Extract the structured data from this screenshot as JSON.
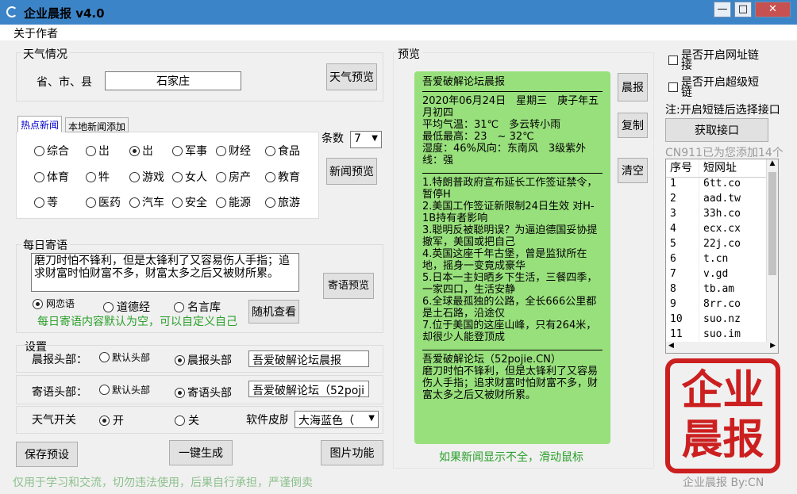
{
  "window": {
    "title": "企业晨报 v4.0",
    "min": "—",
    "max": "□",
    "close": "✕"
  },
  "menu": {
    "about": "关于作者"
  },
  "weather": {
    "group_title": "天气情况",
    "region_label": "省、市、县",
    "region_value": "石家庄",
    "preview_button": "天气预览"
  },
  "news": {
    "tabs": [
      "热点新闻",
      "本地新闻添加"
    ],
    "categories": [
      "综合",
      "岀",
      "岀",
      "军事",
      "财经",
      "食品",
      "体育",
      "牪",
      "游戏",
      "女人",
      "房产",
      "教育",
      "䓁",
      "医药",
      "汽车",
      "安全",
      "能源",
      "旅游"
    ],
    "selected_index": 2,
    "count_label": "条数",
    "count_value": "7",
    "preview_button": "新闻预览"
  },
  "quote": {
    "group_title": "每日寄语",
    "text": "磨刀时怕不锋利，但是太锋利了又容易伤人手指；追求财富时怕财富不多，财富太多之后又被财所累。",
    "options": [
      "网恋语",
      "道德经",
      "名言库"
    ],
    "selected_index": 0,
    "random_button": "随机查看",
    "preview_button": "寄语预览",
    "hint": "每日寄语内容默认为空，可以自定义自己"
  },
  "settings": {
    "group_title": "设置",
    "header_label": "晨报头部：",
    "header_default": "默认头部",
    "header_custom": "晨报头部",
    "header_value": "吾爱破解论坛晨报",
    "quote_label": "寄语头部：",
    "quote_default": "默认头部",
    "quote_custom": "寄语头部",
    "quote_value": "吾爱破解论坛（52poji",
    "weather_label": "天气开关",
    "weather_on": "开",
    "weather_off": "关",
    "skin_label": "软件皮肤",
    "skin_value": "大海蓝色（"
  },
  "bottom_buttons": {
    "save": "保存预设",
    "generate": "一键生成",
    "image": "图片功能"
  },
  "preview": {
    "group_title": "预览",
    "title": "吾爱破解论坛晨报",
    "weather_lines": [
      "2020年06月24日　星期三　庚子年五月初四",
      "平均气温：31℃　多云转小雨",
      "最低最高：23　~ 32℃",
      "湿度：46%风向：东南风　3级紫外线：强"
    ],
    "news_lines": [
      "1.特朗普政府宣布延长工作签证禁令，暂停H",
      "2.美国工作签证新限制24日生效 对H-1B持有者影响",
      "3.聪明反被聪明误？为逼迫德国妥协提撤军，美国或把自己",
      "4.英国这座千年古堡，曾是监狱所在地，摇身一变竟成豪华",
      "5.日本一主妇晒乡下生活，三餐四季，一家四口，生活安静",
      "6.全球最孤独的公路，全长666公里都是土石路，沿途仅",
      "7.位于美国的这座山峰，只有264米，却很少人能登顶成"
    ],
    "footer_lines": [
      "吾爱破解论坛（52pojie.CN）",
      "磨刀时怕不锋利，但是太锋利了又容易伤人手指；追求财富时怕财富不多，财富太多之后又被财所累。"
    ],
    "side_buttons": [
      "晨报",
      "复制",
      "清空"
    ],
    "hint": "如果新闻显示不全，滑动鼠标"
  },
  "shortlink": {
    "option_url": "是否开启网址链接",
    "option_short": "是否开启超级短链",
    "note": "注:开启短链后选择接口",
    "get_button": "获取接口",
    "count_text": "CN911已为您添加14个",
    "headers": [
      "序号",
      "短网址"
    ],
    "rows": [
      [
        "1",
        "6tt.co"
      ],
      [
        "2",
        "aad.tw"
      ],
      [
        "3",
        "33h.co"
      ],
      [
        "4",
        "ecx.cx"
      ],
      [
        "5",
        "22j.co"
      ],
      [
        "6",
        "t.cn"
      ],
      [
        "7",
        "v.gd"
      ],
      [
        "8",
        "tb.am"
      ],
      [
        "9",
        "8rr.co"
      ],
      [
        "10",
        "suo.nz"
      ],
      [
        "11",
        "suo.im"
      ]
    ]
  },
  "stamp": {
    "text": "企业晨报"
  },
  "status": {
    "disclaimer": "仅用于学习和交流，切勿违法使用，后果自行承担，严谨倒卖",
    "credit": "企业晨报 By:CN"
  }
}
